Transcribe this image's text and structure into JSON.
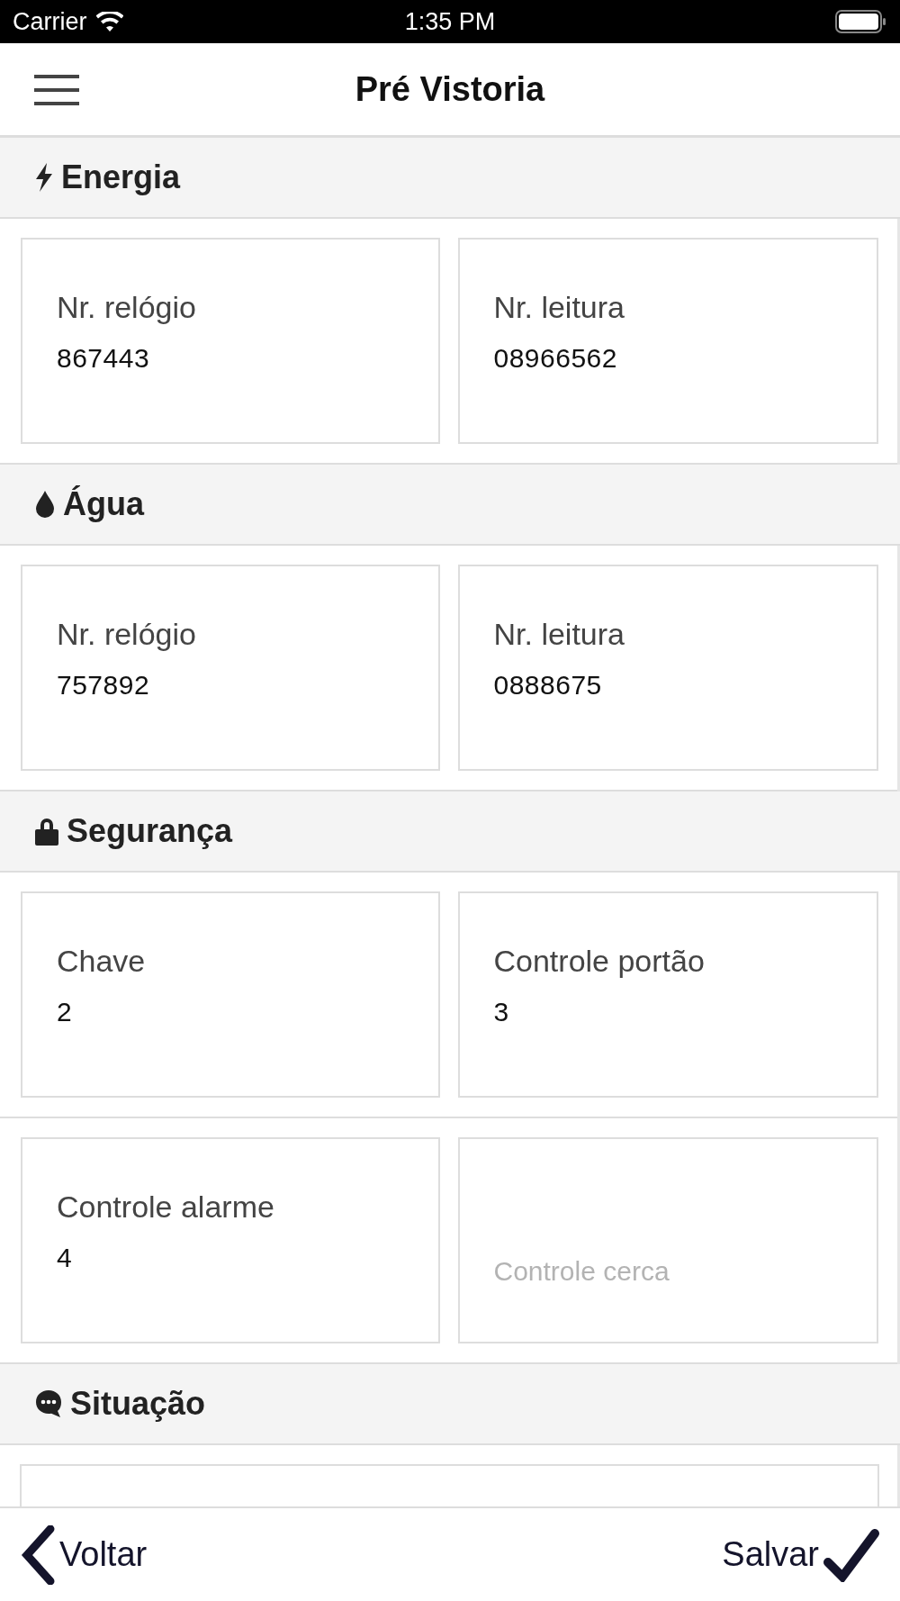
{
  "status_bar": {
    "carrier": "Carrier",
    "time": "1:35 PM"
  },
  "header": {
    "title": "Pré Vistoria"
  },
  "sections": [
    {
      "title": "Energia",
      "kind": "grid",
      "fields": [
        {
          "label": "Nr. relógio",
          "value": "867443"
        },
        {
          "label": "Nr. leitura",
          "value": "08966562"
        }
      ]
    },
    {
      "title": "Água",
      "kind": "grid",
      "fields": [
        {
          "label": "Nr. relógio",
          "value": "757892"
        },
        {
          "label": "Nr. leitura",
          "value": "0888675"
        }
      ]
    },
    {
      "title": "Segurança",
      "kind": "grid",
      "fields": [
        {
          "label": "Chave",
          "value": "2"
        },
        {
          "label": "Controle portão",
          "value": "3"
        },
        {
          "label": "Controle alarme",
          "value": "4"
        },
        {
          "placeholder": "Controle cerca"
        }
      ]
    },
    {
      "title": "Situação",
      "kind": "textarea"
    }
  ],
  "footer": {
    "back": "Voltar",
    "save": "Salvar"
  }
}
